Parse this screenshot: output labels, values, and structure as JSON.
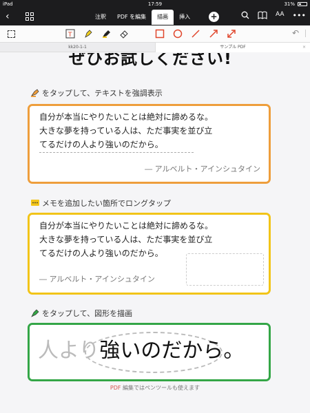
{
  "status": {
    "device": "iPad",
    "time": "17:59",
    "battery": "31%"
  },
  "nav": {
    "tabs": [
      {
        "label": "注釈",
        "active": false
      },
      {
        "label": "PDF を編集",
        "active": false
      },
      {
        "label": "描画",
        "active": true
      },
      {
        "label": "挿入",
        "active": false
      }
    ],
    "aa": "AA"
  },
  "doc_tabs": [
    "kk20-1-1",
    "サンプル PDF"
  ],
  "page": {
    "headline": "ぜひお試しください!",
    "step1": "をタップして、テキストを強調表示",
    "step2": "メモを追加したい箇所でロングタップ",
    "step3": "をタップして、図形を描画",
    "quote_lines": [
      "自分が本当にやりたいことは絶対に諦めるな。",
      "大きな夢を持っている人は、ただ事実を並び立",
      "てるだけの人より強いのだから。"
    ],
    "author": "― アルベルト・アインシュタイン",
    "big_faint": "人より",
    "big_text": "強いのだから。",
    "footer_pdf": "PDF",
    "footer_rest": " 編集ではペンツールも使えます"
  },
  "colors": {
    "orange": "#ee9e3c",
    "yellow": "#f2c418",
    "green": "#34a647",
    "shape_red": "#e0452b"
  }
}
